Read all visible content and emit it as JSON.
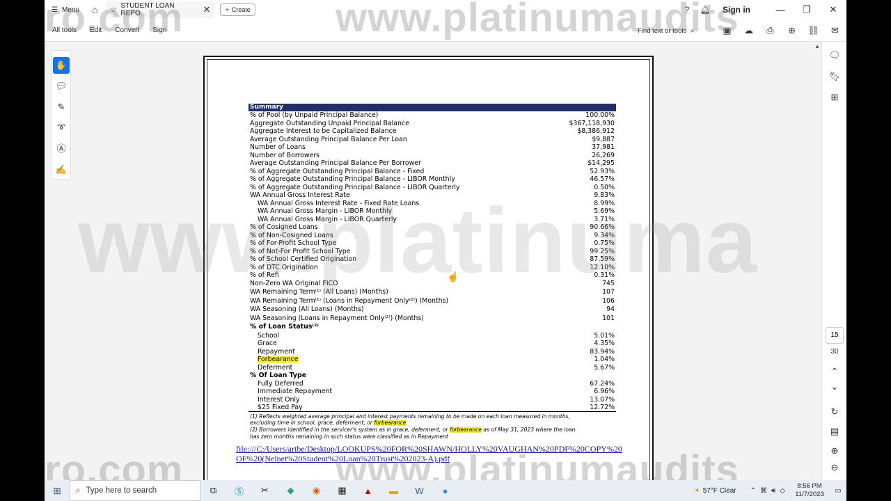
{
  "titlebar": {
    "menu_label": "Menu",
    "tab_title": "STUDENT LOAN REPO...",
    "create_label": "Create",
    "signin_label": "Sign in"
  },
  "toolbar": {
    "items": [
      "All tools",
      "Edit",
      "Convert",
      "Sign"
    ],
    "find_label": "Find text or tools"
  },
  "right_panel": {
    "page_current": "15",
    "page_total": "30"
  },
  "watermark": {
    "text_top": "www.platinumaudits",
    "text_left": "ro.com",
    "text_mid": "www.platinuma"
  },
  "summary": {
    "header": "Summary",
    "rows": [
      {
        "label": "% of Pool (by Unpaid Principal Balance)",
        "value": "100.00%"
      },
      {
        "label": "Aggregate Outstanding Unpaid Principal Balance",
        "value": "$367,118,930"
      },
      {
        "label": "Aggregate Interest to be Capitalized Balance",
        "value": "$8,386,912"
      },
      {
        "label": "Average Outstanding Principal Balance Per Loan",
        "value": "$9,887"
      },
      {
        "label": "Number of Loans",
        "value": "37,981"
      },
      {
        "label": "Number of Borrowers",
        "value": "26,269"
      },
      {
        "label": "Average Outstanding Principal Balance Per Borrower",
        "value": "$14,295"
      },
      {
        "label": "% of Aggregate Outstanding Principal Balance - Fixed",
        "value": "52.93%"
      },
      {
        "label": "% of Aggregate Outstanding Principal Balance - LIBOR Monthly",
        "value": "46.57%"
      },
      {
        "label": "% of Aggregate Outstanding Principal Balance - LIBOR Quarterly",
        "value": "0.50%"
      },
      {
        "label": "WA Annual Gross Interest Rate",
        "value": "9.83%"
      },
      {
        "label": "WA Annual Gross Interest Rate - Fixed Rate Loans",
        "value": "8.99%",
        "indent": true
      },
      {
        "label": "WA Annual Gross Margin - LIBOR Monthly",
        "value": "5.69%",
        "indent": true
      },
      {
        "label": "WA Annual Gross Margin - LIBOR Quarterly",
        "value": "3.71%",
        "indent": true
      },
      {
        "label": "% of Cosigned Loans",
        "value": "90.66%"
      },
      {
        "label": "% of Non-Cosigned Loans",
        "value": "9.34%"
      },
      {
        "label": "% of For-Profit School Type",
        "value": "0.75%"
      },
      {
        "label": "% of Not-For Profit School Type",
        "value": "99.25%"
      },
      {
        "label": "% of School Certified Origination",
        "value": "87.59%"
      },
      {
        "label": "% of DTC Origination",
        "value": "12.10%"
      },
      {
        "label": "% of Refi",
        "value": "0.31%"
      },
      {
        "label": "Non-Zero WA Original FICO",
        "value": "745",
        "tall": true
      },
      {
        "label": "WA Remaining Term⁽¹⁾ (All Loans) (Months)",
        "value": "107",
        "tall": true
      },
      {
        "label": "WA Remaining Term⁽¹⁾ (Loans in Repayment Only⁽²⁾) (Months)",
        "value": "106",
        "tall": true
      },
      {
        "label": "WA Seasoning (All Loans) (Months)",
        "value": "94",
        "tall": true
      },
      {
        "label": "WA Seasoning (Loans in Repayment Only⁽²⁾) (Months)",
        "value": "101",
        "tall": true
      },
      {
        "label": "% of Loan Status⁽²⁾",
        "value": "",
        "bold": true,
        "tall": true
      },
      {
        "label": "School",
        "value": "5.01%",
        "indent": true
      },
      {
        "label": "Grace",
        "value": "4.35%",
        "indent": true
      },
      {
        "label": "Repayment",
        "value": "83.94%",
        "indent": true
      },
      {
        "label": "Forbearance",
        "value": "1.04%",
        "indent": true,
        "highlight": true
      },
      {
        "label": "Deferment",
        "value": "5.67%",
        "indent": true
      },
      {
        "label": "% Of Loan Type",
        "value": "",
        "bold": true
      },
      {
        "label": "Fully Deferred",
        "value": "67.24%",
        "indent": true
      },
      {
        "label": "Immediate Repayment",
        "value": "6.96%",
        "indent": true
      },
      {
        "label": "Interest Only",
        "value": "13.07%",
        "indent": true
      },
      {
        "label": "$25 Fixed Pay",
        "value": "12.72%",
        "indent": true
      }
    ],
    "footnote1_a": "(1) Reflects weighted average principal and interest payments remaining to be made on each loan measured in months,",
    "footnote1_b": "excluding time in school, grace, deferment, or ",
    "footnote1_hl": "forbearance",
    "footnote2_a": "(2) Borrowers identified in the servicer's system as in grace, deferment, or ",
    "footnote2_hl": "forbearance",
    "footnote2_b": " as of May 31, 2023 where the loan",
    "footnote2_c": "has zero months remaining in such status were classified as in Repayment"
  },
  "file_url": "file:///C:/Users/artbe/Desktop/LOOKUPS%20FOR%20SHAWN/HOLLY%20VAUGHAN%20PDF%20COPY%20OF%20(Nelnet%20Student%20Loan%20Trust%202023-A).pdf",
  "taskbar": {
    "search_placeholder": "Type here to search",
    "weather": "57°F  Clear",
    "time": "8:56 PM",
    "date": "11/7/2023"
  }
}
